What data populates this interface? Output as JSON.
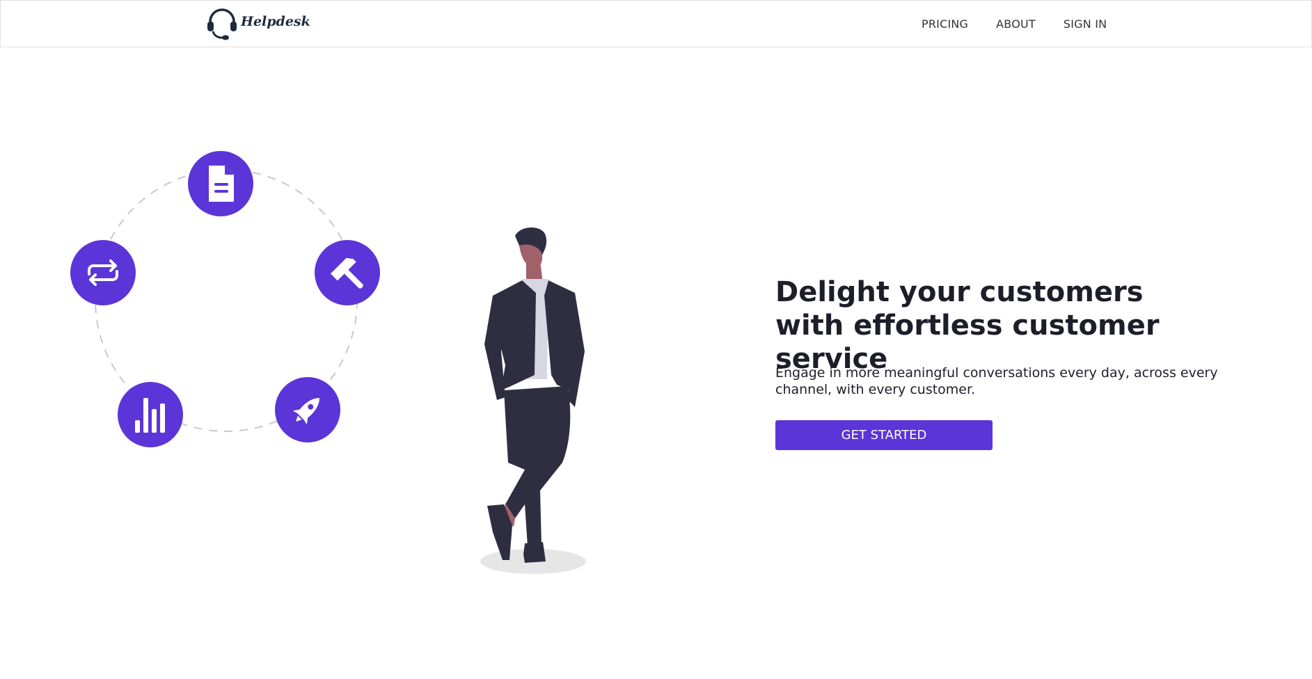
{
  "brand": {
    "name": "Helpdesk",
    "logo_icon": "headset-icon"
  },
  "nav": {
    "links": [
      "PRICING",
      "ABOUT",
      "SIGN IN"
    ]
  },
  "hero": {
    "title": "Delight your customers with effortless customer service",
    "subtitle": "Engage in more meaningful conversations every day, across every channel, with every customer.",
    "cta_label": "GET STARTED"
  },
  "features": {
    "icons": [
      "document-icon",
      "hammer-icon",
      "rocket-icon",
      "bar-chart-icon",
      "repeat-icon"
    ]
  },
  "colors": {
    "accent": "#5c35d8",
    "text_dark": "#1e1e2a",
    "logo": "#1e2a3d",
    "suit": "#2f2e41",
    "skin": "#a0616a",
    "shadow": "#e6e6e6"
  }
}
